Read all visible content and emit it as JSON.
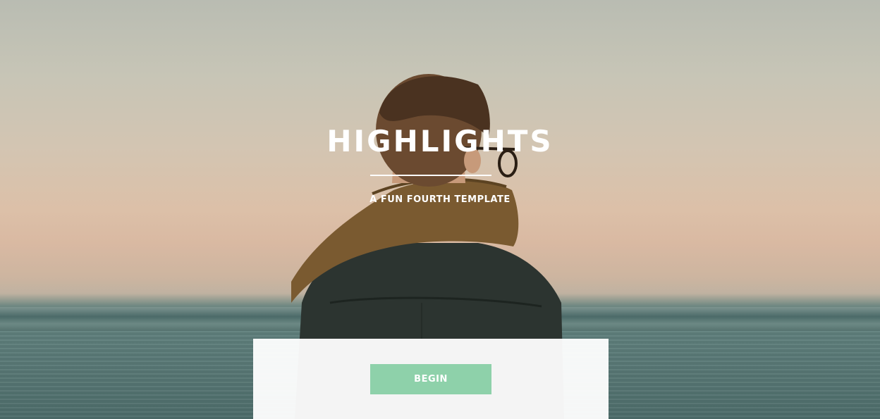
{
  "hero": {
    "title": "HIGHLIGHTS",
    "subtitle": "A FUN FOURTH TEMPLATE",
    "background_image": "person-with-scarf-at-sea-photo"
  },
  "cta": {
    "begin_label": "BEGIN"
  },
  "colors": {
    "accent": "#8ed1aa",
    "title_text": "#ffffff",
    "panel_background": "#ffffff"
  }
}
